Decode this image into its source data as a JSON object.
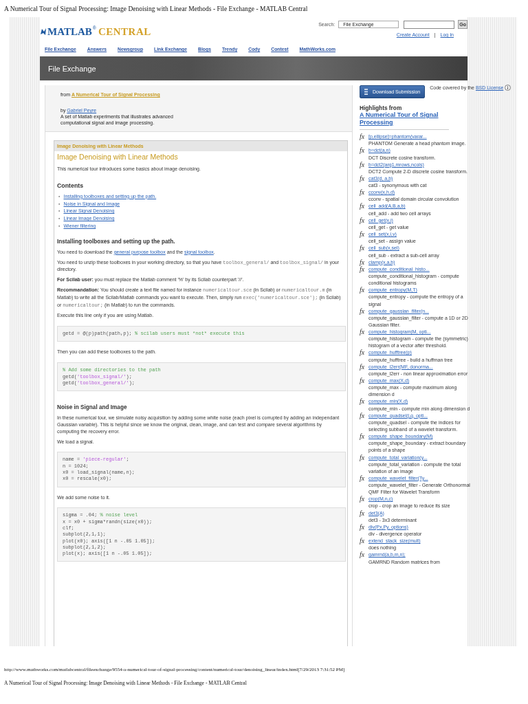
{
  "document_title": "A Numerical Tour of Signal Processing: Image Denoising with Linear Methods - File Exchange - MATLAB Central",
  "logo": {
    "brand": "MATLAB",
    "mark": "®",
    "product": "CENTRAL"
  },
  "search": {
    "label": "Search:",
    "scope": "File Exchange",
    "button": "Go"
  },
  "account": {
    "create": "Create Account",
    "separator": "|",
    "login": "Log In"
  },
  "nav": [
    "File Exchange",
    "Answers",
    "Newsgroup",
    "Link Exchange",
    "Blogs",
    "Trendy",
    "Cody",
    "Contest",
    "MathWorks.com"
  ],
  "banner": "File Exchange",
  "submission": {
    "from_label": "from",
    "package": "A Numerical Tour of Signal Processing",
    "by_label": "by",
    "author": "Gabriel Peyre",
    "description": "A set of Matlab experiments that illustrates advanced computational signal and image processing."
  },
  "document": {
    "tab_title": "Image Denoising with Linear Methods",
    "blocks": [
      {
        "kind": "title",
        "text": "Image Denoising with Linear Methods"
      },
      {
        "kind": "paragraph",
        "segments": [
          {
            "kind": "text",
            "text": "This numerical tour introduces some basics about image denoising."
          }
        ]
      },
      {
        "kind": "heading",
        "text": "Contents"
      },
      {
        "kind": "contents",
        "items": [
          {
            "marker": "▪",
            "text": "Installing toolboxes and setting up the path."
          },
          {
            "marker": "▪",
            "text": "Noise in Signal and Image"
          },
          {
            "marker": "▪",
            "text": "Linear Signal Denoising"
          },
          {
            "marker": "▪",
            "text": "Linear Image Denoising"
          },
          {
            "marker": "▪",
            "text": "Wiener filtering"
          }
        ]
      },
      {
        "kind": "heading",
        "text": "Installing toolboxes and setting up the path."
      },
      {
        "kind": "paragraph",
        "segments": [
          {
            "kind": "text",
            "text": "You need to download the "
          },
          {
            "kind": "link",
            "text": "general purpose toolbox"
          },
          {
            "kind": "text",
            "text": " and the "
          },
          {
            "kind": "link",
            "text": "signal toolbox"
          },
          {
            "kind": "text",
            "text": "."
          }
        ]
      },
      {
        "kind": "paragraph",
        "segments": [
          {
            "kind": "text",
            "text": "You need to unzip these toolboxes in your working directory, so that you have "
          },
          {
            "kind": "code",
            "text": "toolbox_general/"
          },
          {
            "kind": "text",
            "text": " and "
          },
          {
            "kind": "code",
            "text": "toolbox_signal/"
          },
          {
            "kind": "text",
            "text": " in your directory."
          }
        ]
      },
      {
        "kind": "paragraph",
        "segments": [
          {
            "kind": "bold",
            "text": "For Scilab user:"
          },
          {
            "kind": "text",
            "text": " you must replace the Matlab comment '%' by its Scilab counterpart '//'."
          }
        ]
      },
      {
        "kind": "paragraph",
        "segments": [
          {
            "kind": "bold",
            "text": "Recommandation:"
          },
          {
            "kind": "text",
            "text": " You should create a text file named for instance "
          },
          {
            "kind": "code",
            "text": "numericaltour.sce"
          },
          {
            "kind": "text",
            "text": " (in Scilab) or "
          },
          {
            "kind": "code",
            "text": "numericaltour.m"
          },
          {
            "kind": "text",
            "text": " (in Matlab) to write all the Scilab/Matlab commands you want to execute. Then, simply run "
          },
          {
            "kind": "code",
            "text": "exec('numericaltour.sce');"
          },
          {
            "kind": "text",
            "text": " (in Scilab) or "
          },
          {
            "kind": "code",
            "text": "numericaltour;"
          },
          {
            "kind": "text",
            "text": " (in Matlab) to run the commands."
          }
        ]
      },
      {
        "kind": "paragraph",
        "segments": [
          {
            "kind": "text",
            "text": "Execute this line only if you are using Matlab."
          }
        ]
      },
      {
        "kind": "code",
        "lines": [
          [
            {
              "kind": "plain",
              "text": "getd = @(p)path(path,p); "
            },
            {
              "kind": "comment",
              "text": "% scilab users must *not* execute this"
            }
          ]
        ]
      },
      {
        "kind": "paragraph",
        "segments": [
          {
            "kind": "text",
            "text": "Then you can add these toolboxes to the path."
          }
        ]
      },
      {
        "kind": "code",
        "lines": [
          [
            {
              "kind": "comment",
              "text": "% Add some directories to the path"
            }
          ],
          [
            {
              "kind": "plain",
              "text": "getd("
            },
            {
              "kind": "string",
              "text": "'toolbox_signal/'"
            },
            {
              "kind": "plain",
              "text": ");"
            }
          ],
          [
            {
              "kind": "plain",
              "text": "getd("
            },
            {
              "kind": "string",
              "text": "'toolbox_general/'"
            },
            {
              "kind": "plain",
              "text": ");"
            }
          ]
        ]
      },
      {
        "kind": "heading",
        "text": "Noise in Signal and Image"
      },
      {
        "kind": "paragraph",
        "segments": [
          {
            "kind": "text",
            "text": "In these numerical tour, we simulate noisy acquisition by adding some white noise (each pixel is corrupted by adding an independant Gaussian variable). This is helpful since we know the original, clean, image, and can test and compare several algorithms by computing the recovery error."
          }
        ]
      },
      {
        "kind": "paragraph",
        "segments": [
          {
            "kind": "text",
            "text": "We load a signal."
          }
        ]
      },
      {
        "kind": "code",
        "lines": [
          [
            {
              "kind": "plain",
              "text": "name = "
            },
            {
              "kind": "string",
              "text": "'piece-regular'"
            },
            {
              "kind": "plain",
              "text": ";"
            }
          ],
          [
            {
              "kind": "plain",
              "text": "n = 1024;"
            }
          ],
          [
            {
              "kind": "plain",
              "text": "x0 = load_signal(name,n);"
            }
          ],
          [
            {
              "kind": "plain",
              "text": "x0 = rescale(x0);"
            }
          ]
        ]
      },
      {
        "kind": "paragraph",
        "segments": [
          {
            "kind": "text",
            "text": "We add some noise to it."
          }
        ]
      },
      {
        "kind": "code",
        "lines": [
          [
            {
              "kind": "plain",
              "text": "sigma = .04; "
            },
            {
              "kind": "comment",
              "text": "% noise level"
            }
          ],
          [
            {
              "kind": "plain",
              "text": "x = x0 + sigma*randn(size(x0));"
            }
          ],
          [
            {
              "kind": "plain",
              "text": "clf;"
            }
          ],
          [
            {
              "kind": "plain",
              "text": "subplot(2,1,1);"
            }
          ],
          [
            {
              "kind": "plain",
              "text": "plot(x0); axis([1 n -.05 1.05]);"
            }
          ],
          [
            {
              "kind": "plain",
              "text": "subplot(2,1,2);"
            }
          ],
          [
            {
              "kind": "plain",
              "text": "plot(x); axis([1 n -.05 1.05]);"
            }
          ]
        ]
      }
    ]
  },
  "sidebar": {
    "download": "Download Submission",
    "license_text": "Code covered by the",
    "license_link": "BSD License",
    "highlights_label": "Highlights from",
    "highlights_link": "A Numerical Tour of Signal Processing",
    "items": [
      {
        "marker": "fx",
        "signature": "[p,ellipse]=phantom(varar...",
        "description": "PHANTOM Generate a head phantom image."
      },
      {
        "marker": "fx",
        "signature": "b=dct(a,n)",
        "description": "DCT  Discrete cosine transform."
      },
      {
        "marker": "fx",
        "signature": "b=dct2(arg1,mrows,ncols)",
        "description": "DCT2 Compute 2-D discrete cosine transform."
      },
      {
        "marker": "fx",
        "signature": "cat3(d, a,b)",
        "description": "cat3 - synonymous with cat"
      },
      {
        "marker": "fx",
        "signature": "cconv(x,h,d)",
        "description": "cconv - spatial domain circular convolution"
      },
      {
        "marker": "fx",
        "signature": "cell_add(A,B,a,b)",
        "description": "cell_add - add two cell arrays"
      },
      {
        "marker": "fx",
        "signature": "cell_get(x,i)",
        "description": "cell_get - get value"
      },
      {
        "marker": "fx",
        "signature": "cell_set(x,i,v)",
        "description": "cell_set - assign value"
      },
      {
        "marker": "fx",
        "signature": "cell_sub(x,sel)",
        "description": "cell_sub - extract a sub-cell array"
      },
      {
        "marker": "fx",
        "signature": "clamp(x,a,b)"
      },
      {
        "marker": "fx",
        "signature": "compute_conditional_histo...",
        "description": "compute_conditional_histogram - compute conditional histograms"
      },
      {
        "marker": "fx",
        "signature": "compute_entropy(M,T)",
        "description": "compute_entropy - compute the entropy of a signal"
      },
      {
        "marker": "fx",
        "signature": "compute_gaussian_filter(n...",
        "description": "compute_gaussian_filter - compute a 1D or 2D Gaussian filter."
      },
      {
        "marker": "fx",
        "signature": "compute_histogram(M, opti...",
        "description": "compute_histogram - compute the (symmetric) histogram of a vector after threshold."
      },
      {
        "marker": "fx",
        "signature": "compute_hufftree(p)",
        "description": "compute_hufftree - build a huffman tree"
      },
      {
        "marker": "fx",
        "signature": "compute_l2err(MF, donorma...",
        "description": "compute_l2err - non linear approximation error"
      },
      {
        "marker": "fx",
        "signature": "compute_max(X,d)",
        "description": "compute_max - compute maximum along dimension d"
      },
      {
        "marker": "fx",
        "signature": "compute_min(X,d)",
        "description": "compute_min - compute min along dimension d"
      },
      {
        "marker": "fx",
        "signature": "compute_quadsel(j,q, opti...",
        "description": "compute_quadsel - compute the indices for selecting subband of a wavelet transform."
      },
      {
        "marker": "fx",
        "signature": "compute_shape_boundary(M)",
        "description": "compute_shape_boundary - extract boundary points of a shape"
      },
      {
        "marker": "fx",
        "signature": "compute_total_variation(y...",
        "description": "compute_total_variation - compute the total variation of an image"
      },
      {
        "marker": "fx",
        "signature": "compute_wavelet_filter(Ty...",
        "description": "compute_wavelet_filter - Generate Orthonormal QMF Filter for Wavelet Transform"
      },
      {
        "marker": "fx",
        "signature": "crop(M,n,c)",
        "description": "crop - crop an image to reduce its size"
      },
      {
        "marker": "fx",
        "signature": "det3(A)",
        "description": "det3 - 3x3 determinant"
      },
      {
        "marker": "fx",
        "signature": "div(Px,Py, options)",
        "description": "div - divergence operator"
      },
      {
        "marker": "fx",
        "signature": "extend_stack_size(mult)",
        "description": "does nothing"
      },
      {
        "marker": "fx",
        "signature": "gamrnd(a,b,m,n);",
        "description": "GAMRND Random matrices from"
      }
    ]
  },
  "footer": {
    "url": "http://www.mathworks.com/matlabcentral/fileexchange/9554-a-numerical-tour-of-signal-processing/content/numerical-tour/denoising_linear/index.html[7/29/2013 7:31:52 PM]",
    "title": "A Numerical Tour of Signal Processing: Image Denoising with Linear Methods - File Exchange - MATLAB Central"
  }
}
